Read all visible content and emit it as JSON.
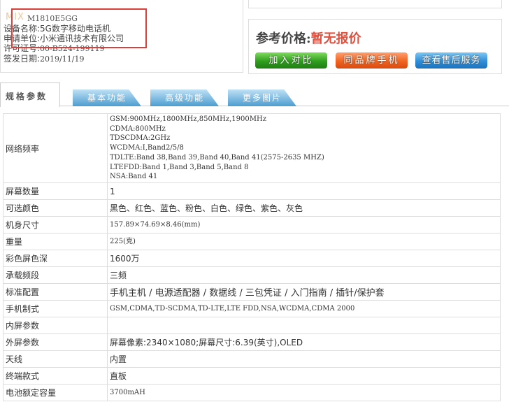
{
  "device": {
    "logo": "MIX",
    "model": "M1810E5GG",
    "rows": [
      {
        "label": "设备名称:",
        "value": "5G数字移动电话机"
      },
      {
        "label": "申请单位:",
        "value": "小米通讯技术有限公司"
      },
      {
        "label": "许可证号:",
        "value": "00-B524-199119"
      },
      {
        "label": "签发日期:",
        "value": "2019/11/19"
      }
    ]
  },
  "price": {
    "label": "参考价格:",
    "value": "暂无报价"
  },
  "buttons": {
    "compare": "加入对比",
    "same_brand": "同品牌手机",
    "service": "查看售后服务"
  },
  "tabs": [
    "规格参数",
    "基本功能",
    "高级功能",
    "更多图片"
  ],
  "specs": {
    "network_label": "网络频率",
    "network_lines": [
      "GSM:900MHz,1800MHz,850MHz,1900MHz",
      "CDMA:800MHz",
      "TDSCDMA:2GHz",
      "WCDMA:I,Band2/5/8",
      "TDLTE:Band 38,Band 39,Band 40,Band 41(2575-2635 MHZ)",
      "LTEFDD:Band 1,Band 3,Band 5,Band 8",
      "NSA:Band 41"
    ],
    "rows": [
      {
        "label": "屏幕数量",
        "value": "1"
      },
      {
        "label": "可选颜色",
        "value": "黑色、红色、蓝色、粉色、白色、绿色、紫色、灰色"
      },
      {
        "label": "机身尺寸",
        "value": "157.89×74.69×8.46(mm)"
      },
      {
        "label": "重量",
        "value": "225(克)"
      },
      {
        "label": "彩色屏色深",
        "value": "1600万"
      },
      {
        "label": "承载频段",
        "value": "三频"
      },
      {
        "label": "标准配置",
        "value": "手机主机 / 电源适配器 / 数据线 / 三包凭证 / 入门指南 / 插针/保护套"
      },
      {
        "label": "手机制式",
        "value": "GSM,CDMA,TD-SCDMA,TD-LTE,LTE FDD,NSA,WCDMA,CDMA 2000"
      },
      {
        "label": "内屏参数",
        "value": ""
      },
      {
        "label": "外屏参数",
        "value": "屏幕像素:2340×1080;屏幕尺寸:6.39(英寸),OLED"
      },
      {
        "label": "天线",
        "value": "内置"
      },
      {
        "label": "终端款式",
        "value": "直板"
      },
      {
        "label": "电池额定容量",
        "value": "3700mAH"
      }
    ]
  }
}
